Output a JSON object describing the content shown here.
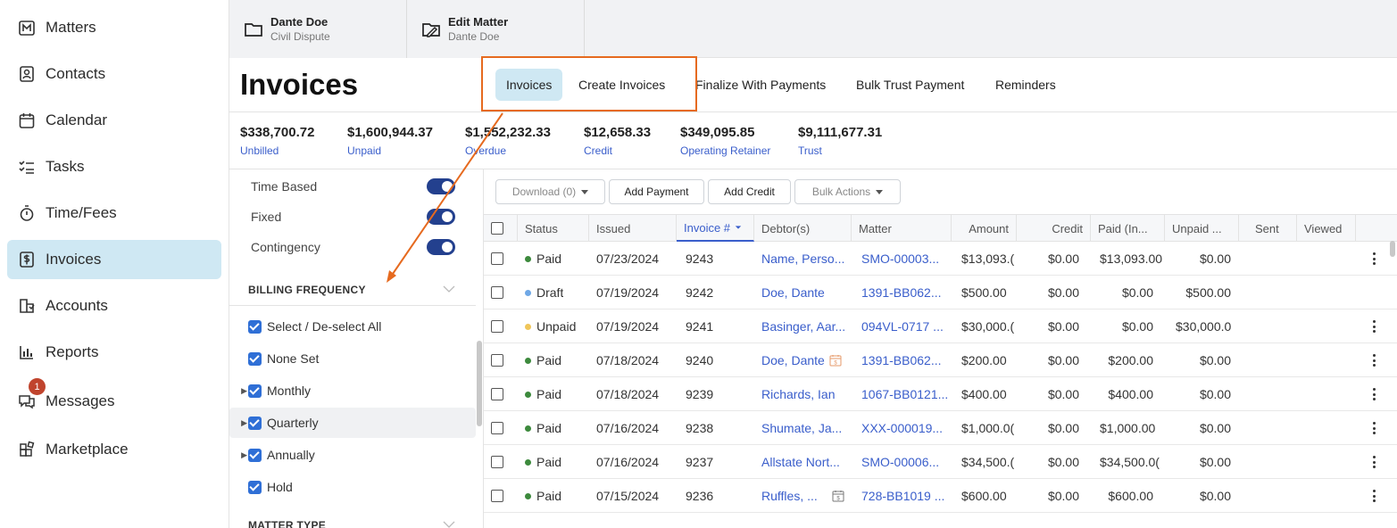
{
  "sidebar": {
    "items": [
      {
        "label": "Matters",
        "icon": "matters-icon"
      },
      {
        "label": "Contacts",
        "icon": "contacts-icon"
      },
      {
        "label": "Calendar",
        "icon": "calendar-icon"
      },
      {
        "label": "Tasks",
        "icon": "tasks-icon"
      },
      {
        "label": "Time/Fees",
        "icon": "stopwatch-icon"
      },
      {
        "label": "Invoices",
        "icon": "invoice-dollar-icon",
        "active": true
      },
      {
        "label": "Accounts",
        "icon": "accounts-icon"
      },
      {
        "label": "Reports",
        "icon": "bar-chart-icon"
      },
      {
        "label": "Messages",
        "icon": "chat-icon",
        "badge": "1"
      },
      {
        "label": "Marketplace",
        "icon": "marketplace-icon"
      }
    ]
  },
  "context_tabs": [
    {
      "title": "Dante Doe",
      "subtitle": "Civil Dispute",
      "icon": "folder-icon"
    },
    {
      "title": "Edit Matter",
      "subtitle": "Dante Doe",
      "icon": "folder-edit-icon"
    }
  ],
  "page_title": "Invoices",
  "subtabs": [
    "Invoices",
    "Create Invoices",
    "Finalize With Payments",
    "Bulk Trust Payment",
    "Reminders"
  ],
  "summary": [
    {
      "value": "$338,700.72",
      "label": "Unbilled"
    },
    {
      "value": "$1,600,944.37",
      "label": "Unpaid"
    },
    {
      "value": "$1,552,232.33",
      "label": "Overdue"
    },
    {
      "value": "$12,658.33",
      "label": "Credit"
    },
    {
      "value": "$349,095.85",
      "label": "Operating Retainer"
    },
    {
      "value": "$9,111,677.31",
      "label": "Trust"
    }
  ],
  "filters": {
    "toggles": [
      "Time Based",
      "Fixed",
      "Contingency"
    ],
    "billing_frequency": {
      "heading": "BILLING FREQUENCY",
      "options": [
        "Select / De-select All",
        "None Set",
        "Monthly",
        "Quarterly",
        "Annually",
        "Hold"
      ]
    },
    "matter_type_heading": "MATTER TYPE"
  },
  "toolbar": {
    "download": "Download (0)",
    "add_payment": "Add Payment",
    "add_credit": "Add Credit",
    "bulk_actions": "Bulk Actions"
  },
  "table": {
    "headers": [
      "Status",
      "Issued",
      "Invoice #",
      "Debtor(s)",
      "Matter",
      "Amount",
      "Credit",
      "Paid (In...",
      "Unpaid ...",
      "Sent",
      "Viewed"
    ],
    "rows": [
      {
        "status": "Paid",
        "issued": "07/23/2024",
        "invoice": "9243",
        "debtor": "Name, Perso...",
        "matter": "SMO-00003...",
        "amount": "$13,093.(",
        "credit": "$0.00",
        "paid": "$13,093.00",
        "unpaid": "$0.00"
      },
      {
        "status": "Draft",
        "issued": "07/19/2024",
        "invoice": "9242",
        "debtor": "Doe, Dante",
        "matter": "1391-BB062...",
        "amount": "$500.00",
        "credit": "$0.00",
        "paid": "$0.00",
        "unpaid": "$500.00"
      },
      {
        "status": "Unpaid",
        "issued": "07/19/2024",
        "invoice": "9241",
        "debtor": "Basinger, Aar...",
        "matter": "094VL-0717 ...",
        "amount": "$30,000.(",
        "credit": "$0.00",
        "paid": "$0.00",
        "unpaid": "$30,000.0("
      },
      {
        "status": "Paid",
        "issued": "07/18/2024",
        "invoice": "9240",
        "debtor": "Doe, Dante",
        "matter": "1391-BB062...",
        "amount": "$200.00",
        "credit": "$0.00",
        "paid": "$200.00",
        "unpaid": "$0.00"
      },
      {
        "status": "Paid",
        "issued": "07/18/2024",
        "invoice": "9239",
        "debtor": "Richards, Ian",
        "matter": "1067-BB0121...",
        "amount": "$400.00",
        "credit": "$0.00",
        "paid": "$400.00",
        "unpaid": "$0.00"
      },
      {
        "status": "Paid",
        "issued": "07/16/2024",
        "invoice": "9238",
        "debtor": "Shumate, Ja...",
        "matter": "XXX-000019...",
        "amount": "$1,000.0(",
        "credit": "$0.00",
        "paid": "$1,000.00",
        "unpaid": "$0.00"
      },
      {
        "status": "Paid",
        "issued": "07/16/2024",
        "invoice": "9237",
        "debtor": "Allstate Nort...",
        "matter": "SMO-00006...",
        "amount": "$34,500.(",
        "credit": "$0.00",
        "paid": "$34,500.0(",
        "unpaid": "$0.00"
      },
      {
        "status": "Paid",
        "issued": "07/15/2024",
        "invoice": "9236",
        "debtor": "Ruffles, ...",
        "matter": "728-BB1019 ...",
        "amount": "$600.00",
        "credit": "$0.00",
        "paid": "$600.00",
        "unpaid": "$0.00"
      }
    ]
  },
  "colors": {
    "accent": "#3a5ecb",
    "active_bg": "#cfe8f3",
    "annotation": "#e66a1f",
    "paid": "#3d8a3d",
    "draft": "#6fa8e6",
    "unpaid": "#f0c65a",
    "toggle": "#23408e"
  }
}
